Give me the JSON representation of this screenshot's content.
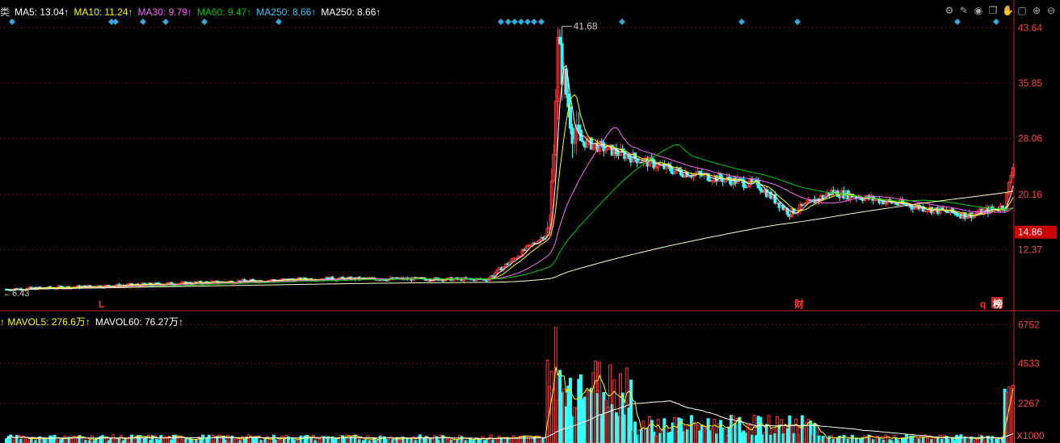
{
  "ma_header": [
    {
      "label": "类",
      "color": "#cccccc"
    },
    {
      "label": "MA5: 13.04↑",
      "color": "#ffffff"
    },
    {
      "label": "MA10: 11.24↑",
      "color": "#ffff00"
    },
    {
      "label": "MA30: 9.79↑",
      "color": "#ff66ff"
    },
    {
      "label": "MA60: 9.47↑",
      "color": "#00cc00"
    },
    {
      "label": "MA250: 8.66↑",
      "color": "#33ccff"
    },
    {
      "label": "MA250: 8.66↑",
      "color": "#ffffff"
    }
  ],
  "vol_header": [
    {
      "label": "↑ MAVOL5: 276.6万↑",
      "color": "#ffff00"
    },
    {
      "label": "MAVOL60: 76.27万↑",
      "color": "#ffffff"
    }
  ],
  "toolbar_icons": [
    "settings-icon",
    "pen-icon",
    "eye-icon",
    "copy-icon",
    "hand-icon",
    "lock-icon",
    "zoom-in-icon",
    "zoom-out-icon"
  ],
  "colors": {
    "up": "#ff3333",
    "down": "#33ffff",
    "axis": "#cc2222",
    "grid": "#661111",
    "ma5": "#ffffff",
    "ma10": "#ffff00",
    "ma30": "#ff66ff",
    "ma60": "#00cc00",
    "ma250": "#ffffcc"
  },
  "chart_data": [
    {
      "type": "candlestick",
      "y_ticks": [
        "43.64",
        "35.85",
        "28.06",
        "20.16",
        "12.37"
      ],
      "y_tick_values": [
        43.64,
        35.85,
        28.06,
        20.16,
        12.37
      ],
      "ylim": [
        5.5,
        45.5
      ],
      "current_price": "14.86",
      "current_price_value": 14.86,
      "max_label": "41.68",
      "min_label": "6.43",
      "event_markers": [
        "L",
        "财",
        "q",
        "榜"
      ],
      "segments": [
        {
          "from": 0,
          "to": 150,
          "start": 6.8,
          "end": 8.3
        },
        {
          "from": 150,
          "to": 230,
          "start": 8.3,
          "end": 8.2
        },
        {
          "from": 230,
          "to": 260,
          "start": 8.2,
          "end": 15.0
        },
        {
          "from": 260,
          "to": 264,
          "start": 15.0,
          "end": 41.0
        },
        {
          "from": 264,
          "to": 272,
          "start": 41.0,
          "end": 28.0
        },
        {
          "from": 272,
          "to": 320,
          "start": 28.0,
          "end": 23.5
        },
        {
          "from": 320,
          "to": 360,
          "start": 23.5,
          "end": 21.5
        },
        {
          "from": 360,
          "to": 375,
          "start": 21.5,
          "end": 17.5
        },
        {
          "from": 375,
          "to": 395,
          "start": 17.5,
          "end": 20.5
        },
        {
          "from": 395,
          "to": 460,
          "start": 20.5,
          "end": 17.2
        },
        {
          "from": 460,
          "to": 478,
          "start": 17.2,
          "end": 18.5
        },
        {
          "from": 478,
          "to": 482,
          "start": 18.5,
          "end": 24.5
        }
      ]
    },
    {
      "type": "bar",
      "y_ticks": [
        "6752",
        "4533",
        "2267"
      ],
      "y_tick_values": [
        6752,
        4533,
        2267
      ],
      "unit": "X1000",
      "ylim": [
        0,
        7100
      ]
    }
  ]
}
